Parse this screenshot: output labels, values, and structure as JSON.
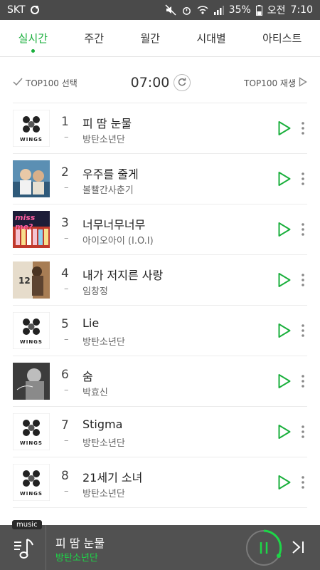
{
  "statusbar": {
    "carrier": "SKT",
    "battery": "35%",
    "ampm": "오전",
    "time": "7:10"
  },
  "tabs": [
    {
      "label": "실시간",
      "active": true
    },
    {
      "label": "주간",
      "active": false
    },
    {
      "label": "월간",
      "active": false
    },
    {
      "label": "시대별",
      "active": false
    },
    {
      "label": "아티스트",
      "active": false
    }
  ],
  "controls": {
    "select_label": "TOP100 선택",
    "time": "07:00",
    "play_label": "TOP100 재생"
  },
  "songs": [
    {
      "rank": "1",
      "change": "–",
      "title": "피 땀 눈물",
      "artist": "방탄소년단",
      "art": "wings"
    },
    {
      "rank": "2",
      "change": "–",
      "title": "우주를 줄게",
      "artist": "볼빨간사춘기",
      "art": "photo-blue"
    },
    {
      "rank": "3",
      "change": "–",
      "title": "너무너무너무",
      "artist": "아이오아이 (I.O.I)",
      "art": "miss-me",
      "art_text": "miss me?"
    },
    {
      "rank": "4",
      "change": "–",
      "title": "내가 저지른 사랑",
      "artist": "임창정",
      "art": "photo-warm",
      "art_text": "12"
    },
    {
      "rank": "5",
      "change": "–",
      "title": "Lie",
      "artist": "방탄소년단",
      "art": "wings"
    },
    {
      "rank": "6",
      "change": "–",
      "title": "숨",
      "artist": "박효신",
      "art": "photo-mono"
    },
    {
      "rank": "7",
      "change": "–",
      "title": "Stigma",
      "artist": "방탄소년단",
      "art": "wings"
    },
    {
      "rank": "8",
      "change": "–",
      "title": "21세기 소녀",
      "artist": "방탄소년단",
      "art": "wings"
    }
  ],
  "art_label_wings": "WINGS",
  "player": {
    "badge": "music",
    "title": "피 땀 눈물",
    "artist": "방탄소년단"
  },
  "colors": {
    "accent": "#1aaf3c",
    "player_bg": "#515151",
    "statusbar_bg": "#4a4a4a"
  }
}
